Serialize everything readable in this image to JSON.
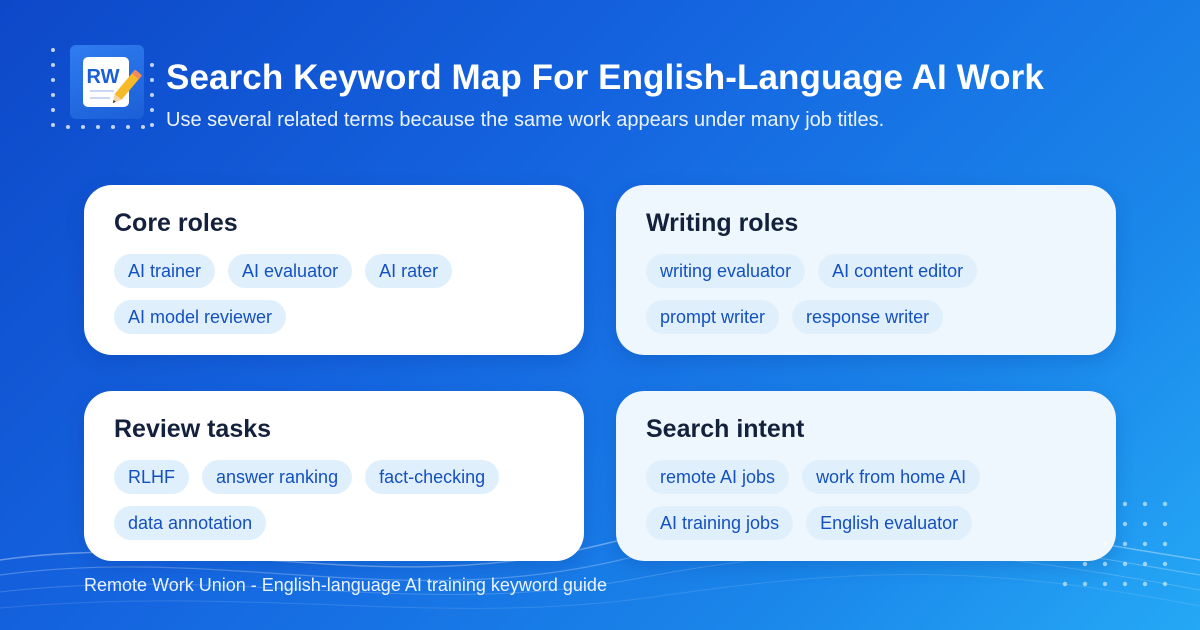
{
  "header": {
    "logo_text": "RW",
    "title": "Search Keyword Map For English-Language AI Work",
    "subtitle": "Use several related terms because the same work appears under many job titles."
  },
  "cards": [
    {
      "title": "Core roles",
      "chips": [
        "AI trainer",
        "AI evaluator",
        "AI rater",
        "AI model reviewer"
      ]
    },
    {
      "title": "Writing roles",
      "chips": [
        "writing evaluator",
        "AI content editor",
        "prompt writer",
        "response writer"
      ]
    },
    {
      "title": "Review tasks",
      "chips": [
        "RLHF",
        "answer ranking",
        "fact-checking",
        "data annotation"
      ]
    },
    {
      "title": "Search intent",
      "chips": [
        "remote AI jobs",
        "work from home AI",
        "AI training jobs",
        "English evaluator"
      ]
    }
  ],
  "footer": {
    "text": "Remote Work Union - English-language AI training keyword guide"
  },
  "colors": {
    "background_start": "#0d48c9",
    "background_end": "#25a8f5",
    "card": "#ffffff",
    "card_tinted": "#eef6fe",
    "chip_bg": "#dff0fc",
    "chip_text": "#1550c0",
    "card_title": "#14213d"
  },
  "icons": [
    "notepad-pencil-icon"
  ]
}
